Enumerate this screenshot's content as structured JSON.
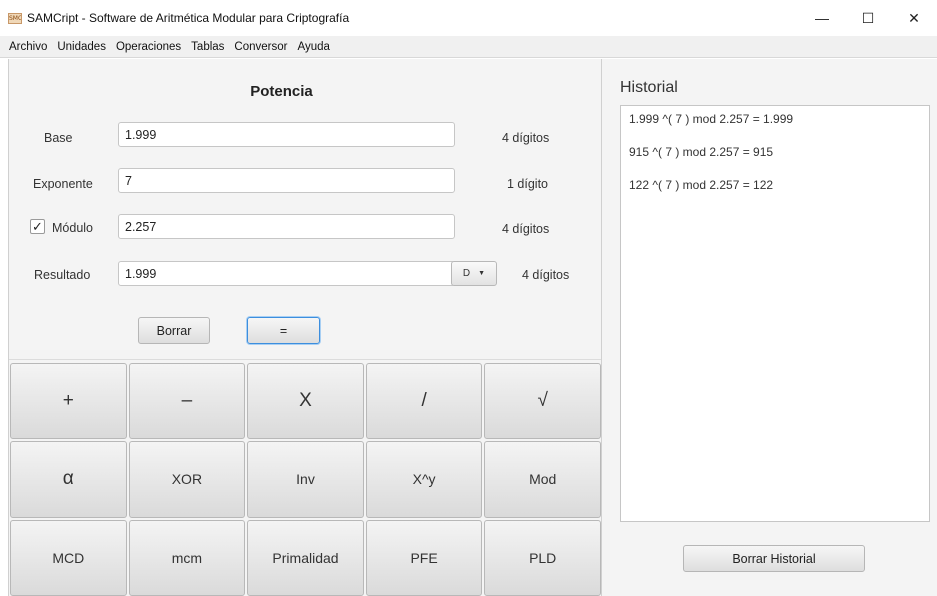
{
  "window": {
    "app_icon_text": "SMC",
    "title": "SAMCript - Software de Aritmética Modular para Criptografía",
    "minimize_glyph": "—",
    "maximize_glyph": "☐",
    "close_glyph": "✕"
  },
  "menu": [
    "Archivo",
    "Unidades",
    "Operaciones",
    "Tablas",
    "Conversor",
    "Ayuda"
  ],
  "panel": {
    "title": "Potencia",
    "base_label": "Base",
    "base_value": "1.999",
    "base_digits": "4 dígitos",
    "exponente_label": "Exponente",
    "exponente_value": "7",
    "exponente_digits": "1 dígito",
    "modulo_checked_glyph": "✓",
    "modulo_label": "Módulo",
    "modulo_value": "2.257",
    "modulo_digits": "4 dígitos",
    "resultado_label": "Resultado",
    "resultado_value": "1.999",
    "format_value": "D",
    "format_arrow": "▼",
    "resultado_digits": "4 dígitos",
    "borrar_label": "Borrar",
    "equals_label": "="
  },
  "keypad": [
    {
      "label": "+",
      "name": "plus"
    },
    {
      "label": "–",
      "name": "minus"
    },
    {
      "label": "X",
      "name": "multiply"
    },
    {
      "label": "/",
      "name": "divide"
    },
    {
      "label": "√",
      "name": "sqrt"
    },
    {
      "label": "α",
      "name": "alpha"
    },
    {
      "label": "XOR",
      "name": "xor"
    },
    {
      "label": "Inv",
      "name": "inv"
    },
    {
      "label": "X^y",
      "name": "power"
    },
    {
      "label": "Mod",
      "name": "mod"
    },
    {
      "label": "MCD",
      "name": "mcd"
    },
    {
      "label": "mcm",
      "name": "mcm"
    },
    {
      "label": "Primalidad",
      "name": "primalidad"
    },
    {
      "label": "PFE",
      "name": "pfe"
    },
    {
      "label": "PLD",
      "name": "pld"
    }
  ],
  "history": {
    "title": "Historial",
    "items": [
      "1.999 ^( 7 ) mod 2.257 = 1.999",
      "915 ^( 7 ) mod 2.257 = 915",
      "122 ^( 7 ) mod 2.257 = 122"
    ],
    "clear_label": "Borrar Historial"
  }
}
